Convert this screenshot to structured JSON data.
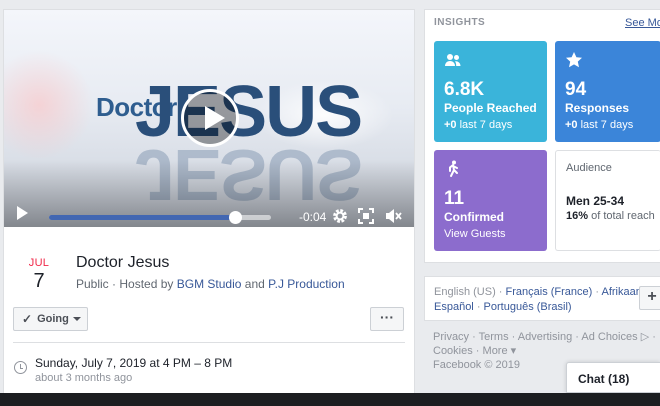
{
  "video": {
    "title_text_small": "Doctor",
    "title_text_large": "JESUS",
    "time_remaining": "-0:04",
    "progress_fraction": 0.84
  },
  "event": {
    "month": "JUL",
    "day": "7",
    "title": "Doctor Jesus",
    "visibility": "Public",
    "hosted_by_prefix": "· Hosted by",
    "host1": "BGM Studio",
    "and": "and",
    "host2": "P.J Production",
    "going_label": "Going",
    "more_label": "···",
    "when": "Sunday, July 7, 2019 at 4 PM – 8 PM",
    "when_relative": "about 3 months ago"
  },
  "insights": {
    "heading": "INSIGHTS",
    "see_more": "See More",
    "reached": {
      "value": "6.8K",
      "label": "People Reached",
      "delta": "+0",
      "period": "last 7 days"
    },
    "responses": {
      "value": "94",
      "label": "Responses",
      "delta": "+0",
      "period": "last 7 days"
    },
    "confirmed": {
      "value": "11",
      "label": "Confirmed",
      "link": "View Guests"
    },
    "audience": {
      "heading": "Audience",
      "main": "Men 25-34",
      "pct": "16%",
      "pct_suffix": "of total reach"
    }
  },
  "languages": {
    "current": "English (US)",
    "options": [
      "Français (France)",
      "Afrikaans",
      "Español",
      "Português (Brasil)"
    ],
    "add_label": "+"
  },
  "footer": {
    "links_line1": [
      "Privacy",
      "Terms",
      "Advertising",
      "Ad Choices"
    ],
    "links_line2": [
      "Cookies",
      "More"
    ],
    "copyright": "Facebook © 2019"
  },
  "chat": {
    "label": "Chat (18)"
  },
  "colors": {
    "reached_tile": "#3ab4da",
    "responses_tile": "#3b85d9",
    "confirmed_tile": "#8c6ccd",
    "link": "#385898",
    "month_red": "#f02849"
  }
}
